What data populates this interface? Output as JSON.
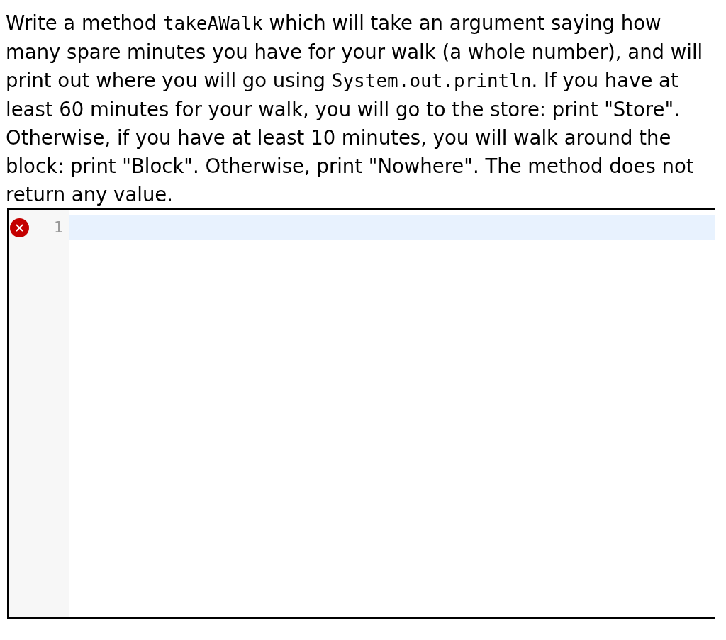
{
  "prompt": {
    "segments": [
      {
        "kind": "text",
        "text": "Write a method "
      },
      {
        "kind": "code",
        "text": "takeAWalk"
      },
      {
        "kind": "text",
        "text": " which will take an argument saying how many spare minutes you have for your walk (a whole number), and will print out where you will go using "
      },
      {
        "kind": "code",
        "text": "System.out.println"
      },
      {
        "kind": "text",
        "text": ". If you have at least 60 minutes for your walk, you will go to the store: print \"Store\". Otherwise, if you have at least 10 minutes, you will walk around the block: print \"Block\". Otherwise, print \"Nowhere\". The method does not return any value."
      }
    ]
  },
  "editor": {
    "lines": [
      {
        "number": "1",
        "active": true,
        "error": true
      }
    ]
  }
}
